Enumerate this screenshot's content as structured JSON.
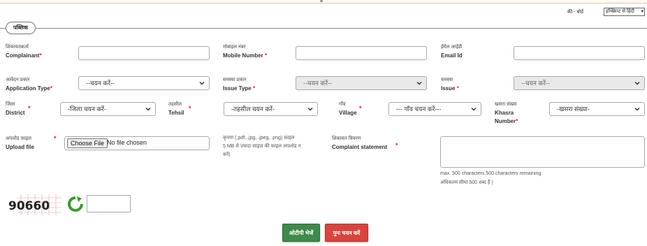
{
  "header": {
    "keyboard_label": "की - बोर्ड",
    "keyboard_select": "इन्स्क्रिप्ट से हिंदी"
  },
  "form": {
    "legend": "पब्लिक",
    "complainant": {
      "label_hi": "शिकायतकर्ता",
      "label_en": "Complainant",
      "required": "*"
    },
    "mobile": {
      "label_hi": "मोबाइल नंबर",
      "label_en": "Mobile Number",
      "required": "*"
    },
    "email": {
      "label_hi": "ईमेल आईडी",
      "label_en": "Email Id"
    },
    "application_type": {
      "label_hi": "आवेदन प्रकार",
      "label_en": "Application Type",
      "required": "*",
      "value": "--चयन करें--"
    },
    "issue_type": {
      "label_hi": "समस्या प्रकार",
      "label_en": "Issue Type",
      "required": "*",
      "value": "--चयन करें--"
    },
    "issue": {
      "label_hi": "समस्या",
      "label_en": "Issue",
      "required": "*",
      "value": "--चयन करें--"
    },
    "district": {
      "label_hi": "जिला",
      "label_en": "District",
      "required": "*",
      "value": "-जिला चयन करें-"
    },
    "tehsil": {
      "label_hi": "तहसील",
      "label_en": "Tehsil",
      "required": "*",
      "value": "-तहसील चयन करें-"
    },
    "village": {
      "label_hi": "गाँव",
      "label_en": "Village",
      "required": "*",
      "value": "--- गाँव चयन करें---"
    },
    "khasra": {
      "label_hi": "खसरा संख्या",
      "label_en_1": "Khasra",
      "label_en_2": "Number",
      "required": "*",
      "value": "-खसरा संख्या-"
    },
    "upload": {
      "label_hi": "अपलोड फ़ाइल",
      "label_en": "Upload file",
      "required": "*",
      "button": "Choose File",
      "status": "No file chosen"
    },
    "upload_note": [
      "कृपया (.pdf, .jpg, .jpeg, .png) फ़ाइल",
      "5 MB से ज़्यादा साइज़ की फ़ाइल अपलोड न",
      "करें|"
    ],
    "statement": {
      "label_hi": "शिकायत विवरण",
      "label_en": "Complaint statement",
      "required": "*"
    },
    "statement_hint_1": "max. 500 characters.500 characters remaining",
    "statement_hint_2": "अधिकतम सीमा 500 शब्द हैं |"
  },
  "captcha": {
    "code": "90660"
  },
  "buttons": {
    "otp": "ओटीपी भेजें",
    "reset": "पुनः चयन करें"
  },
  "colors": {
    "otp_button": "#3e8a4a",
    "reset_button": "#d9443c",
    "required": "#dd2222"
  }
}
